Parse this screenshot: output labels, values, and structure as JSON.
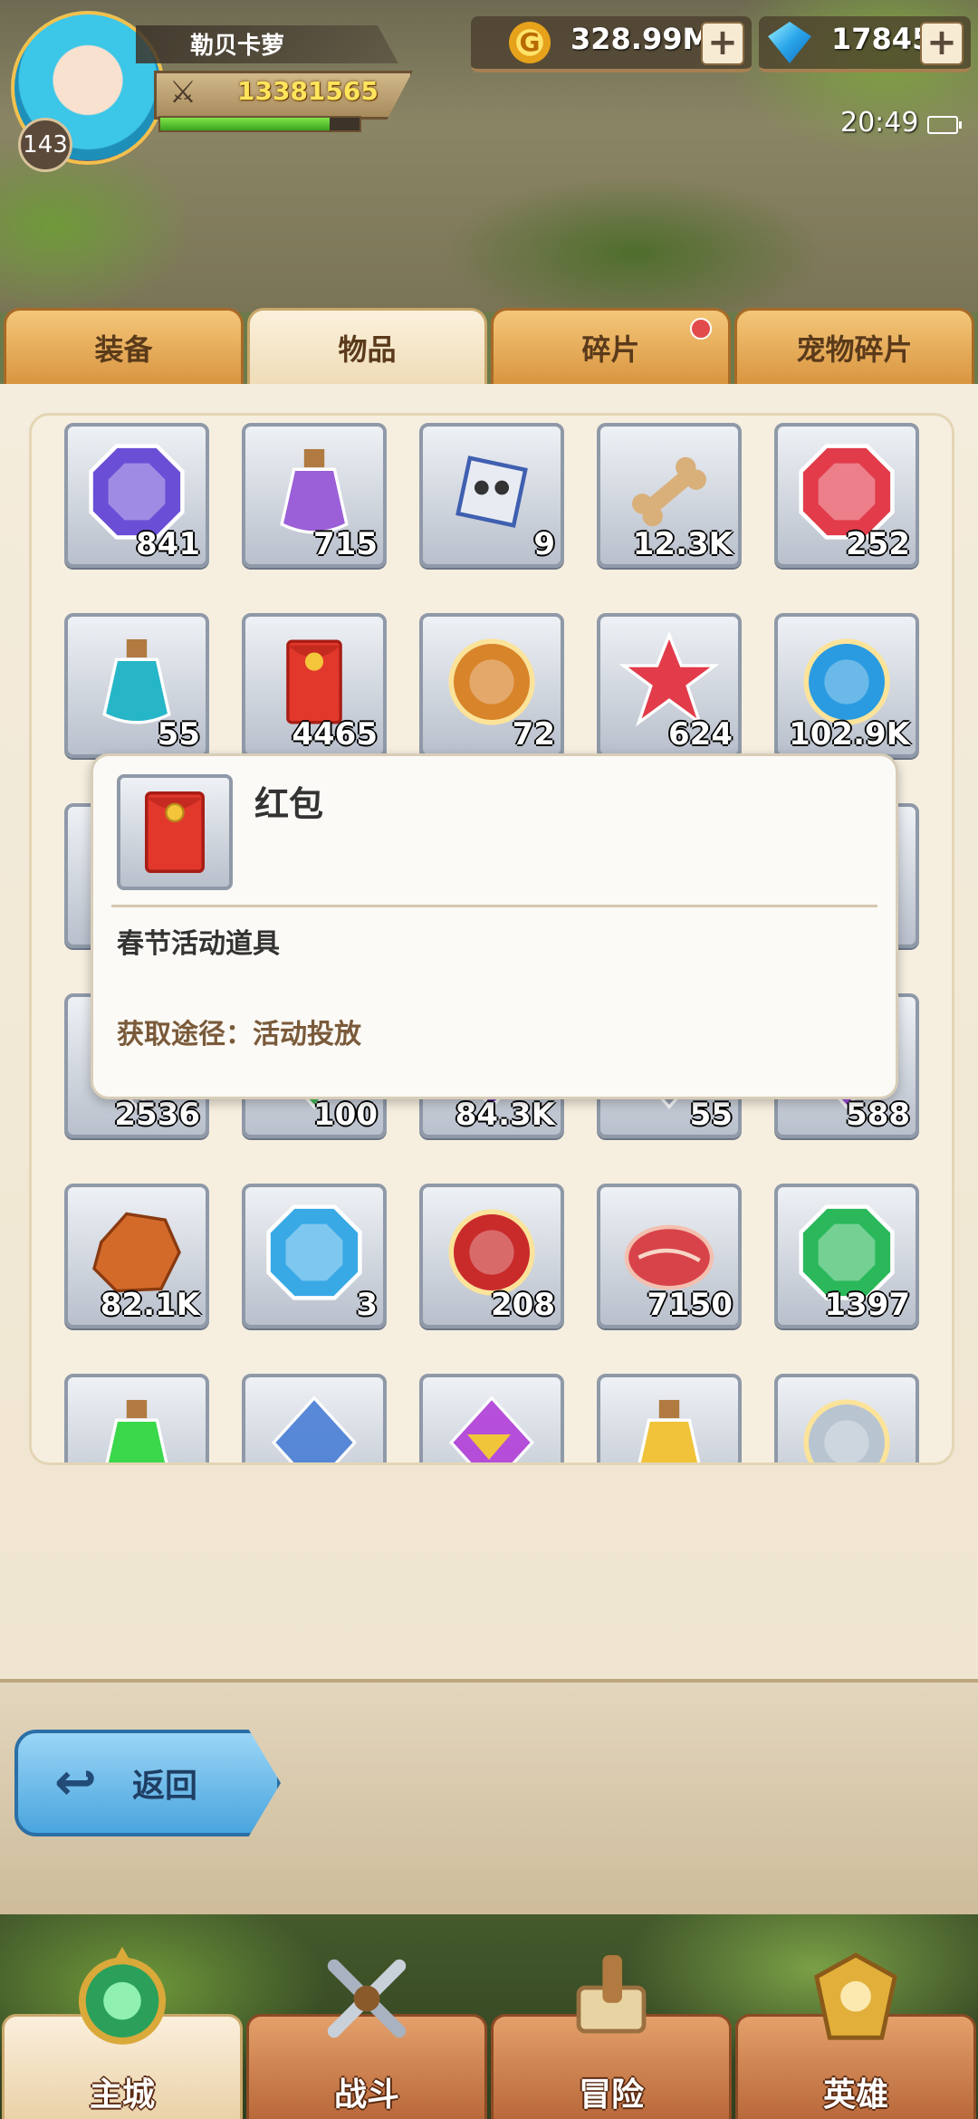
{
  "player": {
    "name": "勒贝卡萝",
    "level": "143",
    "power": "13381565",
    "exp_progress": 0.85
  },
  "currency": {
    "gold": "328.99M",
    "gems": "17845"
  },
  "status": {
    "time": "20:49"
  },
  "tabs": [
    {
      "label": "装备",
      "active": false,
      "badge": false
    },
    {
      "label": "物品",
      "active": true,
      "badge": false
    },
    {
      "label": "碎片",
      "active": false,
      "badge": true
    },
    {
      "label": "宠物碎片",
      "active": false,
      "badge": false
    }
  ],
  "items": [
    {
      "icon": "octagon-gem-icon",
      "qty": "841",
      "color": "#6a4fd6"
    },
    {
      "icon": "potion-bottle-icon",
      "qty": "715",
      "color": "#9b5fd8"
    },
    {
      "icon": "skull-cube-icon",
      "qty": "9",
      "color": "#3f5fb0"
    },
    {
      "icon": "bone-icon",
      "qty": "12.3K",
      "color": "#d9b07a"
    },
    {
      "icon": "red-octagon-gem-icon",
      "qty": "252",
      "color": "#e23b4a"
    },
    {
      "icon": "lamp-icon",
      "qty": "55",
      "color": "#27b6c8"
    },
    {
      "icon": "red-envelope-icon",
      "qty": "4465",
      "color": "#e2382c"
    },
    {
      "icon": "sword-coin-icon",
      "qty": "72",
      "color": "#d8842a"
    },
    {
      "icon": "red-star-icon",
      "qty": "624",
      "color": "#e23b4a"
    },
    {
      "icon": "blue-orb-icon",
      "qty": "102.9K",
      "color": "#2a9be0"
    },
    {
      "icon": "item-icon",
      "qty": "",
      "color": "#d8842a"
    },
    {
      "icon": "heart-icon",
      "qty": "",
      "color": "#e23b4a"
    },
    {
      "icon": "swirl-icon",
      "qty": "",
      "color": "#9aa7b8"
    },
    {
      "icon": "red-potion-icon",
      "qty": "",
      "color": "#e23b4a"
    },
    {
      "icon": "blue-item-icon",
      "qty": "",
      "color": "#2a9be0"
    },
    {
      "icon": "scroll-icon",
      "qty": "2536",
      "color": "#b9c0cc"
    },
    {
      "icon": "green-item-icon",
      "qty": "100",
      "color": "#3ab54a"
    },
    {
      "icon": "purple-item-icon",
      "qty": "84.3K",
      "color": "#7a3fd0"
    },
    {
      "icon": "silver-item-icon",
      "qty": "55",
      "color": "#8f99a8"
    },
    {
      "icon": "purple-crystal-icon",
      "qty": "588",
      "color": "#9b3fd8"
    },
    {
      "icon": "ore-icon",
      "qty": "82.1K",
      "color": "#d36a2a"
    },
    {
      "icon": "blue-octagon-gem-icon",
      "qty": "3",
      "color": "#39a9e6"
    },
    {
      "icon": "crest-coin-icon",
      "qty": "208",
      "color": "#c92a2a"
    },
    {
      "icon": "meat-icon",
      "qty": "7150",
      "color": "#d8434a"
    },
    {
      "icon": "green-octagon-gem-icon",
      "qty": "1397",
      "color": "#2ab85a"
    },
    {
      "icon": "green-potion-icon",
      "qty": "",
      "color": "#3ad84a"
    },
    {
      "icon": "paper-scroll-icon",
      "qty": "",
      "color": "#4a7fd6"
    },
    {
      "icon": "purple-gem-icon",
      "qty": "",
      "color": "#b23fd8"
    },
    {
      "icon": "yellow-potion-icon",
      "qty": "",
      "color": "#f0c33a"
    },
    {
      "icon": "silver-coin-icon",
      "qty": "",
      "color": "#b8c4d0"
    }
  ],
  "tooltip": {
    "title": "红包",
    "description": "春节活动道具",
    "source": "获取途径：活动投放",
    "icon": "red-envelope-icon"
  },
  "back_button": {
    "label": "返回"
  },
  "bottom_nav": [
    {
      "label": "主城",
      "icon": "castle-icon",
      "active": true
    },
    {
      "label": "战斗",
      "icon": "crossed-swords-icon",
      "active": false
    },
    {
      "label": "冒险",
      "icon": "map-scroll-icon",
      "active": false
    },
    {
      "label": "英雄",
      "icon": "hero-crest-icon",
      "active": false
    }
  ]
}
